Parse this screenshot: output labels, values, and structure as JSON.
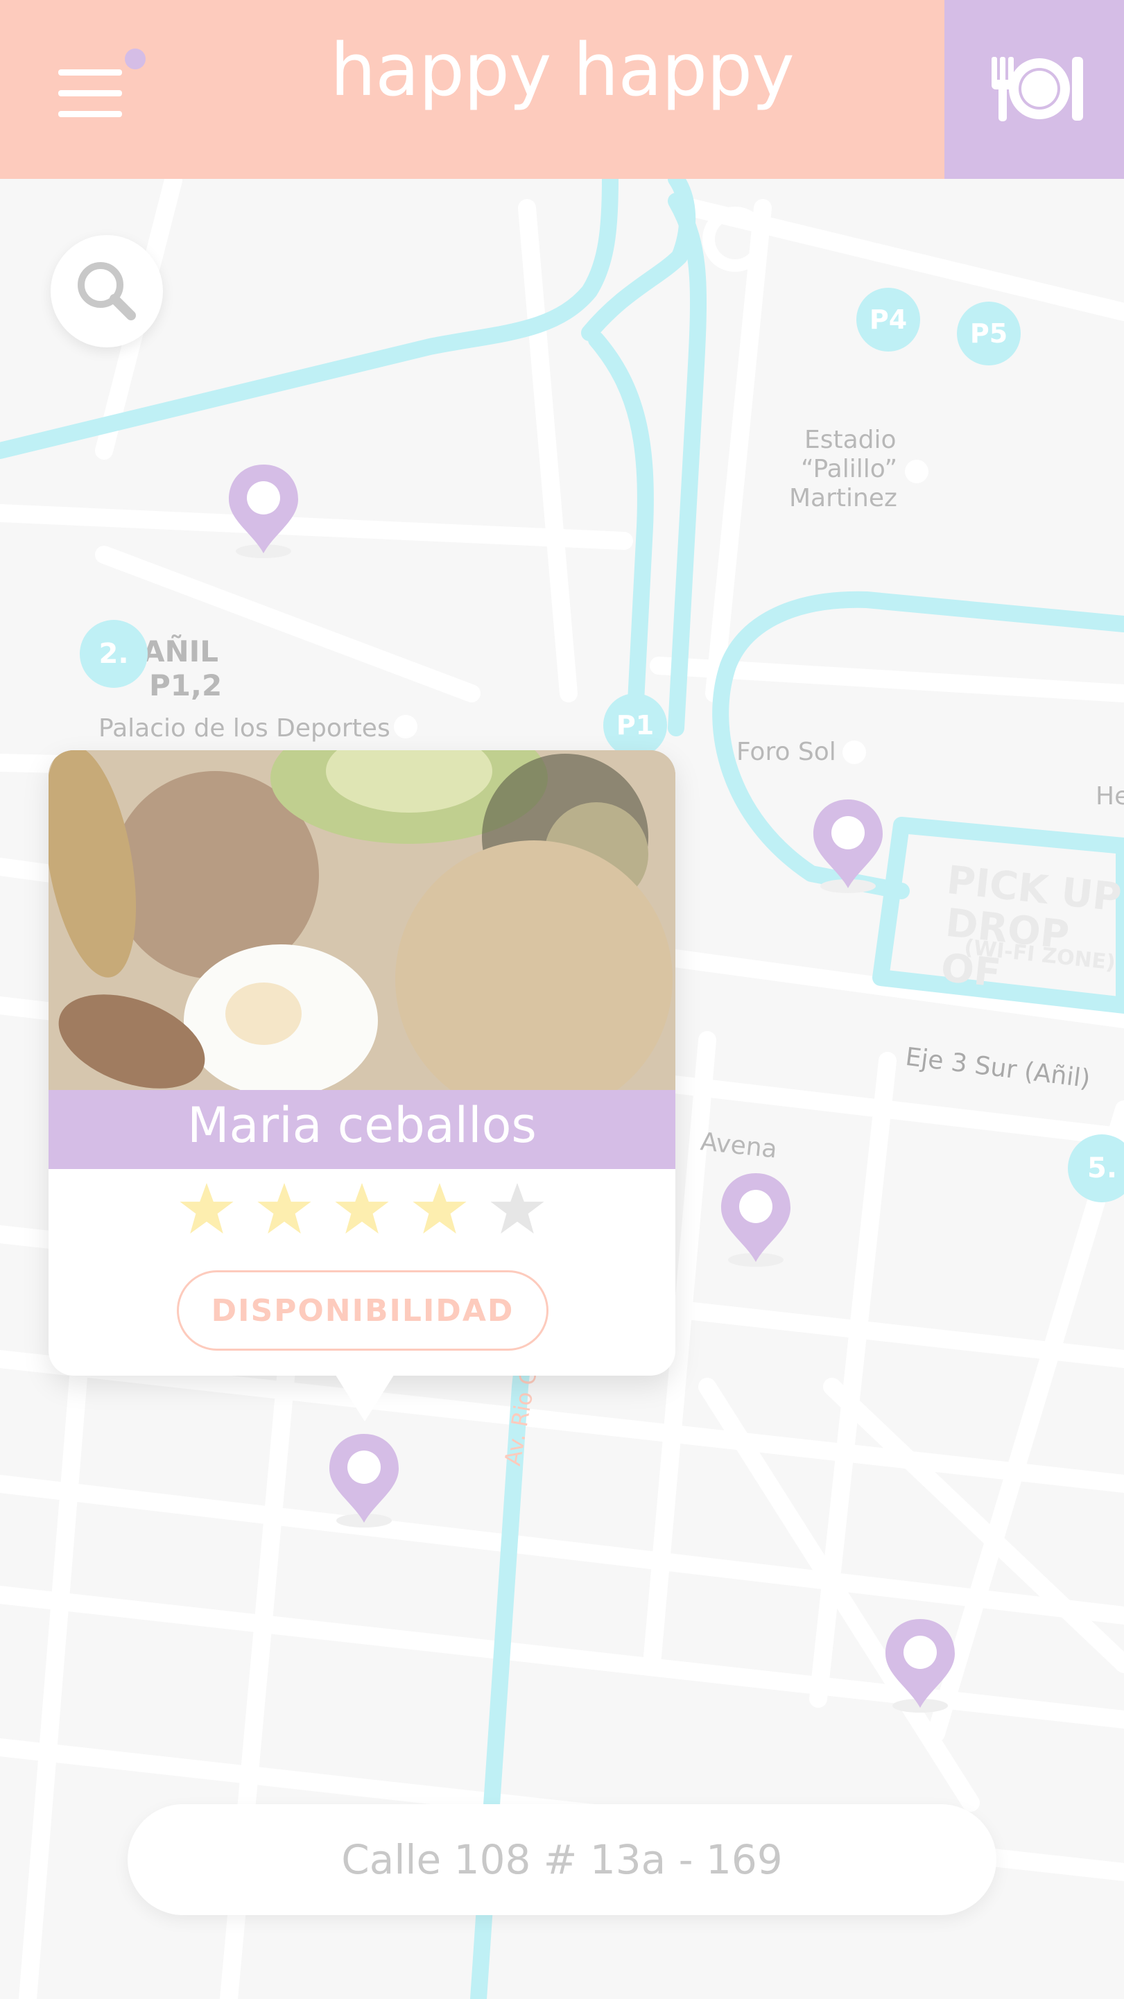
{
  "header": {
    "logo_text": "happy happy",
    "menu_icon": "hamburger-menu-icon",
    "food_icon": "fork-plate-knife-icon"
  },
  "search": {
    "icon": "search-icon"
  },
  "map": {
    "street_labels": [
      "Estadio",
      "“Palillo”",
      "Martinez",
      "AÑIL",
      "P1,2",
      "Palacio de los Deportes",
      "Foro Sol",
      "He",
      "PICK UP",
      "DROP OF",
      "(WI-FI ZONE)",
      "Eje 3 Sur (Añil)",
      "Avena",
      "Av. Rio Churub"
    ],
    "badges": [
      "P4",
      "P5",
      "P1",
      "2.",
      "5."
    ],
    "pin_icon": "map-pin-icon"
  },
  "card": {
    "name": "Maria ceballos",
    "rating": 4,
    "max_rating": 5,
    "button_label": "DISPONIBILIDAD",
    "photo_icon": "food-photo"
  },
  "address": {
    "text": "Calle 108 # 13a - 169"
  },
  "colors": {
    "header_bg": "#fdcbbd",
    "accent_purple": "#d5bde6",
    "road_cyan": "#bff0f5",
    "star_filled": "#fdeeaf",
    "star_empty": "#e6e6e6"
  }
}
